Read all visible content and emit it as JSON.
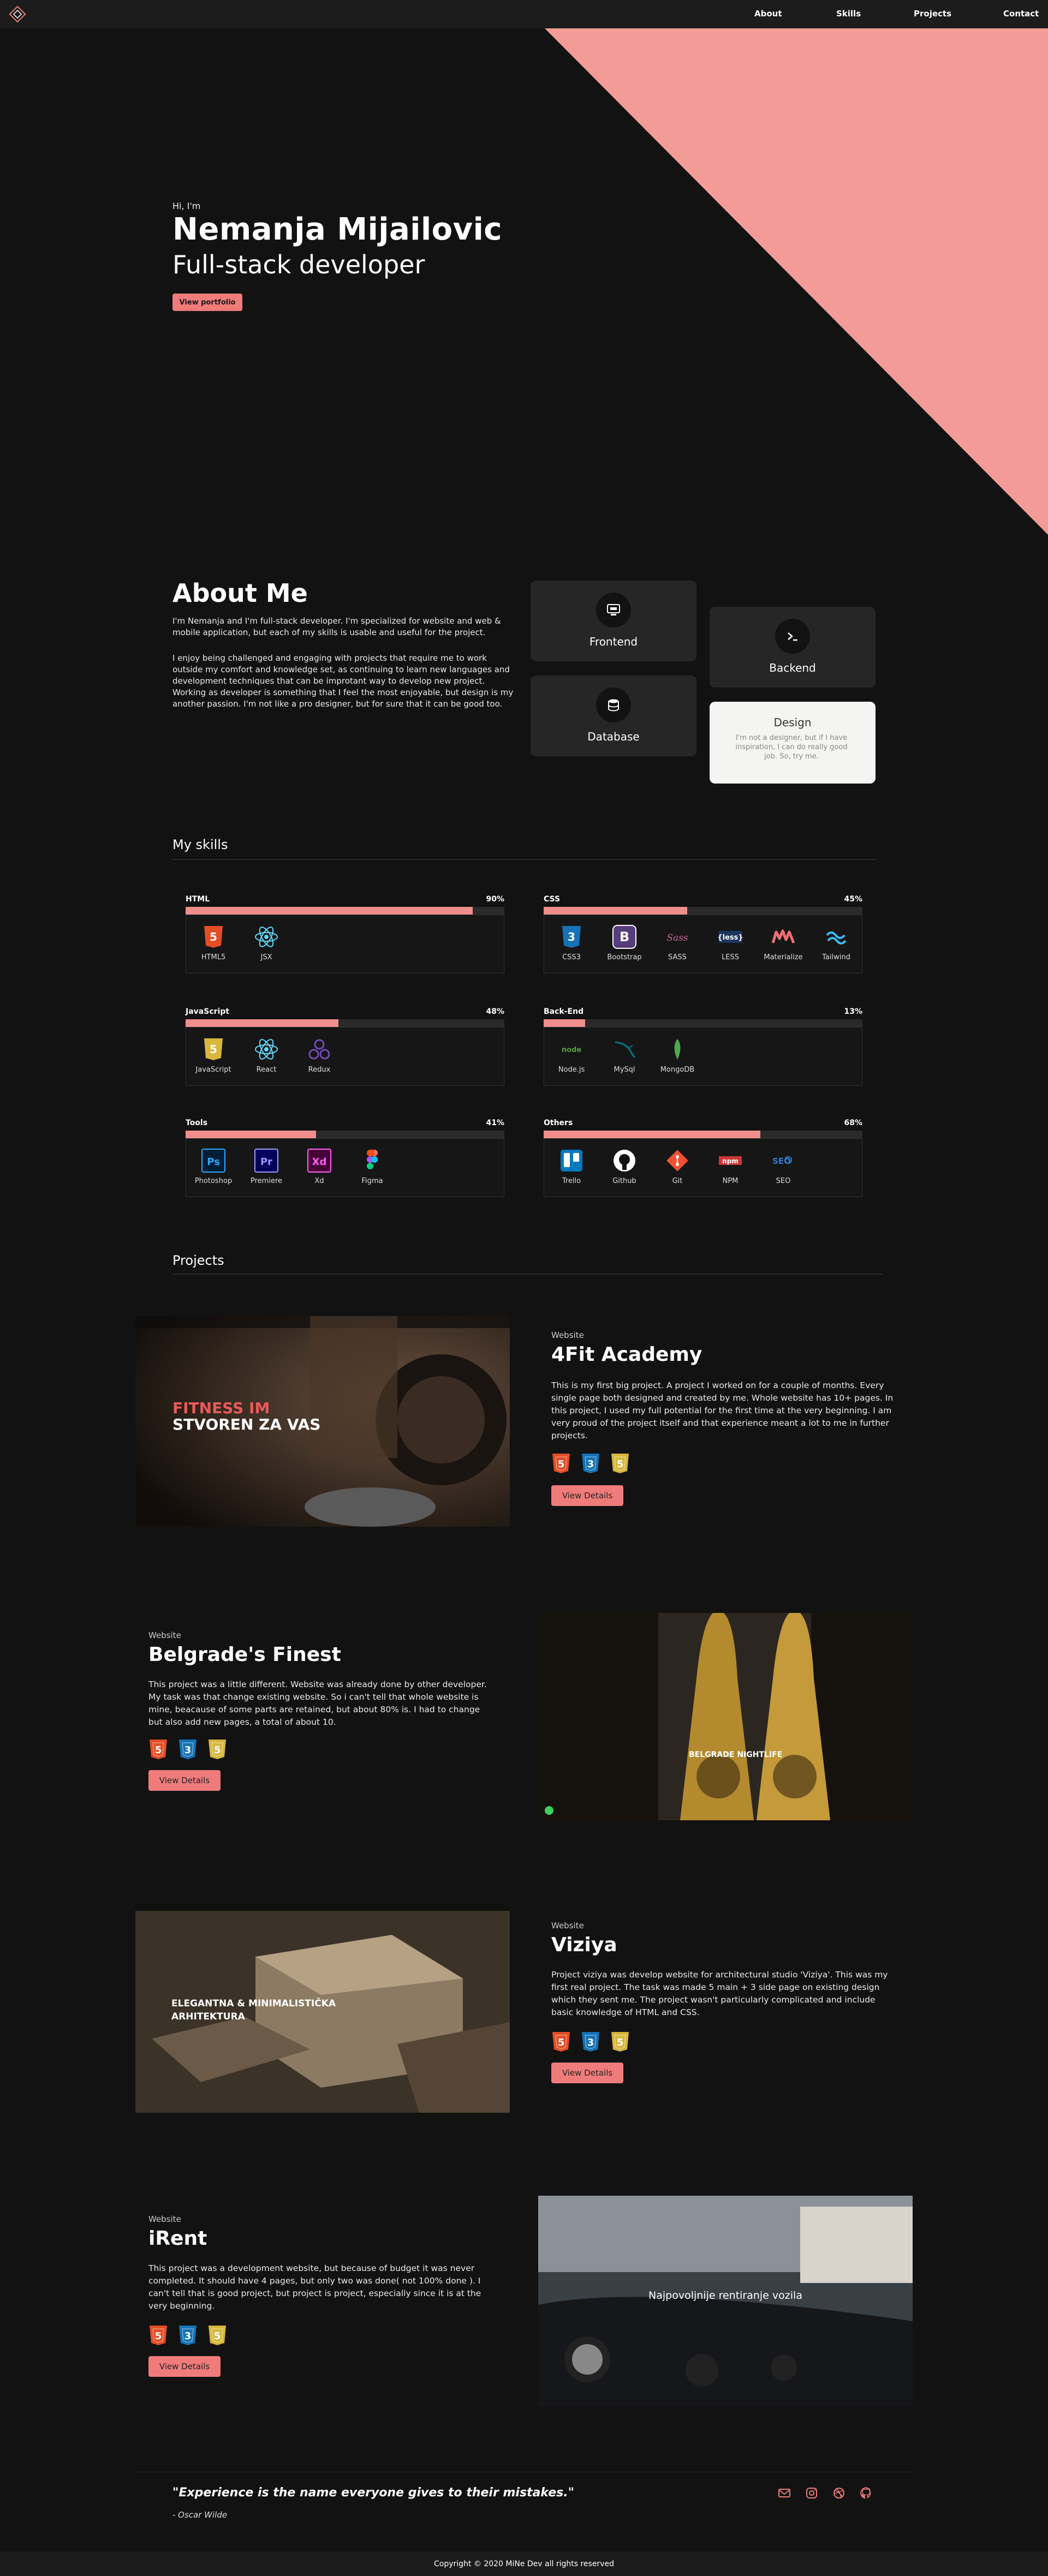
{
  "nav": {
    "links": [
      "About",
      "Skills",
      "Projects",
      "Contact"
    ]
  },
  "hero": {
    "greeting": "Hi, I'm",
    "name": "Nemanja Mijailovic",
    "role": "Full-stack developer",
    "button": "View portfolio",
    "accent": "#f29b97"
  },
  "about": {
    "title": "About Me",
    "paragraph1": "I'm Nemanja and I'm full-stack developer. I'm specialized for website and web & mobile application, but each of my skills is usable and useful for the project.",
    "paragraph2": "I enjoy being challenged and engaging with projects that require me to work outside my comfort and knowledge set, as continuing to learn new languages and development techniques that can be improtant way to develop new project. Working as developer is something that I feel the most enjoyable, but design is my another passion. I'm not like a pro designer, but for sure that it can be good too.",
    "cards": [
      {
        "label": "Frontend",
        "icon": "monitor-icon"
      },
      {
        "label": "Backend",
        "icon": "terminal-icon"
      },
      {
        "label": "Database",
        "icon": "database-icon"
      }
    ],
    "design_card": {
      "title": "Design",
      "text": "I'm not a designer, but if I have inspiration, I can do really good job. So, try me."
    }
  },
  "skills": {
    "title": "My skills",
    "groups": [
      {
        "name": "HTML",
        "percent": "90%",
        "level": 90,
        "techs": [
          "HTML5",
          "JSX"
        ]
      },
      {
        "name": "CSS",
        "percent": "45%",
        "level": 45,
        "techs": [
          "CSS3",
          "Bootstrap",
          "SASS",
          "LESS",
          "Materialize",
          "Tailwind"
        ]
      },
      {
        "name": "JavaScript",
        "percent": "48%",
        "level": 48,
        "techs": [
          "JavaScript",
          "React",
          "Redux"
        ]
      },
      {
        "name": "Back-End",
        "percent": "13%",
        "level": 13,
        "techs": [
          "Node.js",
          "MySql",
          "MongoDB"
        ]
      },
      {
        "name": "Tools",
        "percent": "41%",
        "level": 41,
        "techs": [
          "Photoshop",
          "Premiere",
          "Xd",
          "Figma"
        ]
      },
      {
        "name": "Others",
        "percent": "68%",
        "level": 68,
        "techs": [
          "Trello",
          "Github",
          "Git",
          "NPM",
          "SEO"
        ]
      }
    ]
  },
  "projects": {
    "title": "Projects",
    "items": [
      {
        "kind": "Website",
        "title": "4Fit Academy",
        "desc": "This is my first big project. A project I worked on for a couple of months. Every single page both designed and created by me. Whole website has 10+ pages. In this project, I used my full potential for the first time at the very beginning. I am very proud of the project itself and that experience meant a lot to me in further projects.",
        "button": "View Details",
        "shot": {
          "line1": "FITNESS IM",
          "line2": "STVOREN ZA VAS"
        }
      },
      {
        "kind": "Website",
        "title": "Belgrade's Finest",
        "desc": "This project was a little different. Website was already done by other developer. My task was that change existing website. So i can't tell that whole website is mine, beacause of some parts are retained, but about 80% is. I had to change but also add new pages, a total of about 10.",
        "button": "View Details",
        "shot": {
          "line1": "BELGRADE NIGHTLIFE"
        }
      },
      {
        "kind": "Website",
        "title": "Viziya",
        "desc": "Project viziya was develop website for architectural studio 'Viziya'. This was my first real project. The task was made 5 main + 3 side page on existing design which they sent me. The project wasn't particularly complicated and include basic knowledge of HTML and CSS.",
        "button": "View Details",
        "shot": {
          "line1": "ELEGANTNA & MINIMALISTIČKA",
          "line2": "ARHITEKTURA"
        }
      },
      {
        "kind": "Website",
        "title": "iRent",
        "desc": "This project was a development website, but because of budget it was never completed. It should have 4 pages, but only two was done( not 100% done ). I can't tell that is good project, but project is project, especially since it is at the very beginning.",
        "button": "View Details",
        "shot": {
          "line1": "Najpovoljnije rentiranje vozila"
        }
      }
    ]
  },
  "footer": {
    "quote": "\"Experience is the name everyone gives to their mistakes.\"",
    "author": "- Oscar Wilde",
    "icons": [
      "mail-icon",
      "instagram-icon",
      "dribbble-icon",
      "github-icon"
    ],
    "copyright": "Copyright © 2020 MiNe Dev all rights reserved"
  }
}
